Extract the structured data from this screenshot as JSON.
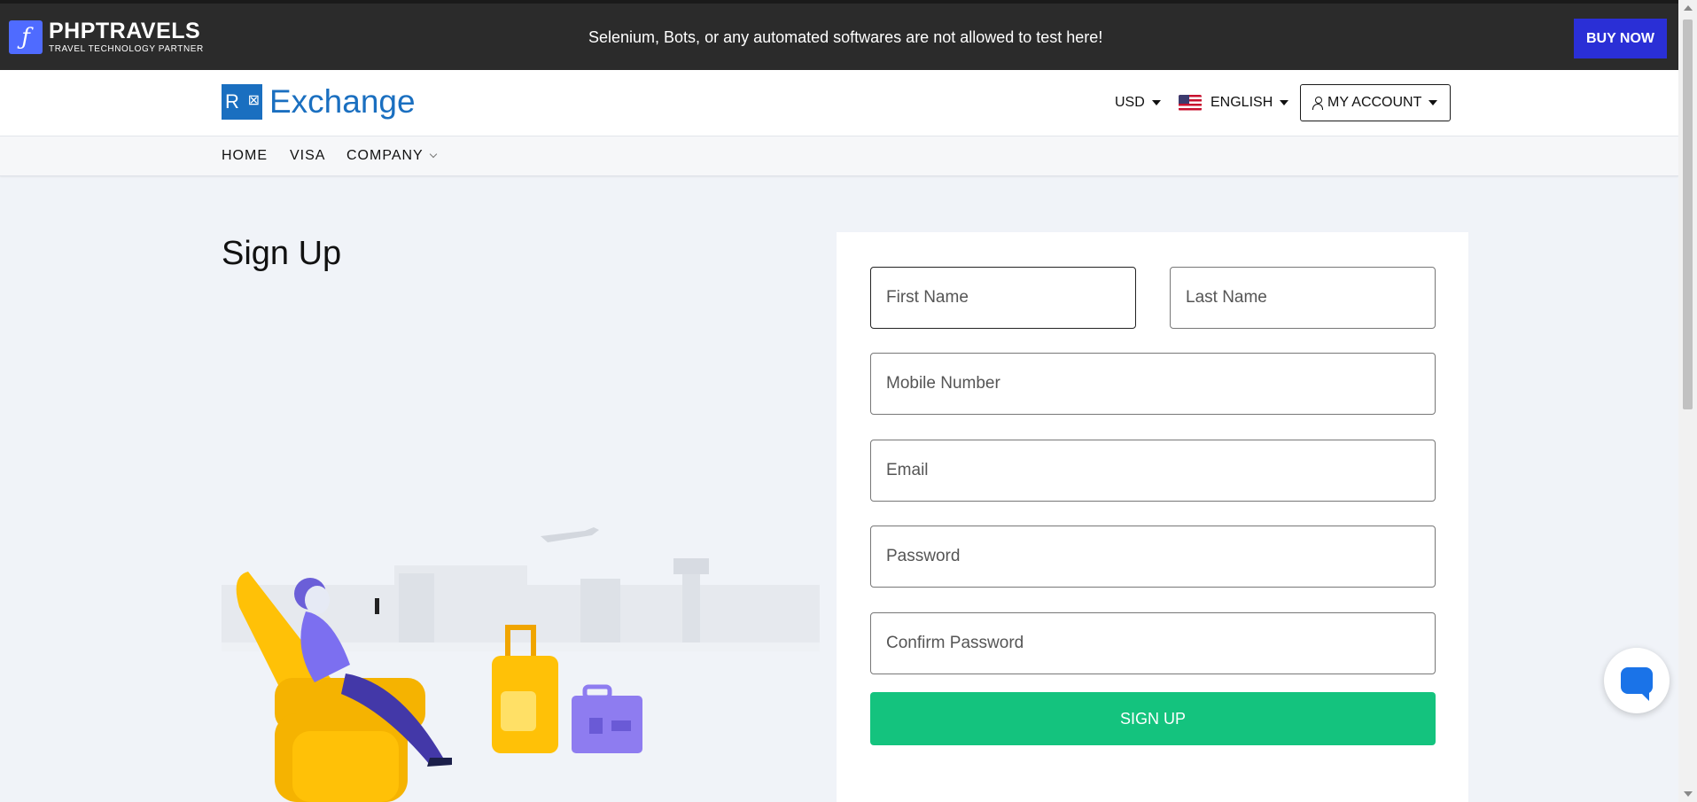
{
  "topbar": {
    "brand_name": "PHPTRAVELS",
    "brand_tagline": "TRAVEL TECHNOLOGY PARTNER",
    "notice": "Selenium, Bots, or any automated softwares are not allowed to test here!",
    "buy_now_label": "BUY NOW"
  },
  "header": {
    "logo_text": "Exchange",
    "currency": "USD",
    "language": "ENGLISH",
    "account_label": "MY ACCOUNT"
  },
  "nav": {
    "items": [
      {
        "label": "HOME"
      },
      {
        "label": "VISA"
      },
      {
        "label": "COMPANY"
      }
    ]
  },
  "main": {
    "title": "Sign Up"
  },
  "form": {
    "first_name_placeholder": "First Name",
    "last_name_placeholder": "Last Name",
    "mobile_placeholder": "Mobile Number",
    "email_placeholder": "Email",
    "password_placeholder": "Password",
    "confirm_password_placeholder": "Confirm Password",
    "signup_label": "SIGN UP"
  },
  "colors": {
    "topbar_bg": "#2b2b2b",
    "buy_now": "#2a2fd6",
    "signup": "#14c37e",
    "logo": "#1a6fc0",
    "page_bg": "#f0f3f8"
  },
  "icons": {
    "brand": "phptravels-logo-icon",
    "currency_caret": "caret-down-icon",
    "flag": "us-flag-icon",
    "account": "user-icon",
    "company_chevron": "chevron-down-icon",
    "chat": "chat-bubble-icon"
  }
}
